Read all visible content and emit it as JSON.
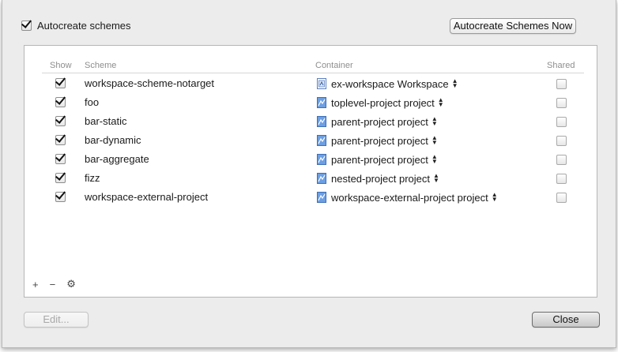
{
  "autocreate": {
    "label": "Autocreate schemes",
    "checked": true
  },
  "buttons": {
    "autocreate_now": "Autocreate Schemes Now",
    "edit": "Edit...",
    "close": "Close"
  },
  "table": {
    "headers": {
      "show": "Show",
      "scheme": "Scheme",
      "container": "Container",
      "shared": "Shared"
    },
    "rows": [
      {
        "show": true,
        "scheme": "workspace-scheme-notarget",
        "container": "ex-workspace Workspace",
        "container_icon": "workspace-icon",
        "shared": false
      },
      {
        "show": true,
        "scheme": "foo",
        "container": "toplevel-project project",
        "container_icon": "project-icon",
        "shared": false
      },
      {
        "show": true,
        "scheme": "bar-static",
        "container": "parent-project project",
        "container_icon": "project-icon",
        "shared": false
      },
      {
        "show": true,
        "scheme": "bar-dynamic",
        "container": "parent-project project",
        "container_icon": "project-icon",
        "shared": false
      },
      {
        "show": true,
        "scheme": "bar-aggregate",
        "container": "parent-project project",
        "container_icon": "project-icon",
        "shared": false
      },
      {
        "show": true,
        "scheme": "fizz",
        "container": "nested-project project",
        "container_icon": "project-icon",
        "shared": false
      },
      {
        "show": true,
        "scheme": "workspace-external-project",
        "container": "workspace-external-project project",
        "container_icon": "project-icon",
        "shared": false
      }
    ]
  },
  "footer": {
    "add_symbol": "+",
    "remove_symbol": "−",
    "gear_symbol": "⚙"
  }
}
